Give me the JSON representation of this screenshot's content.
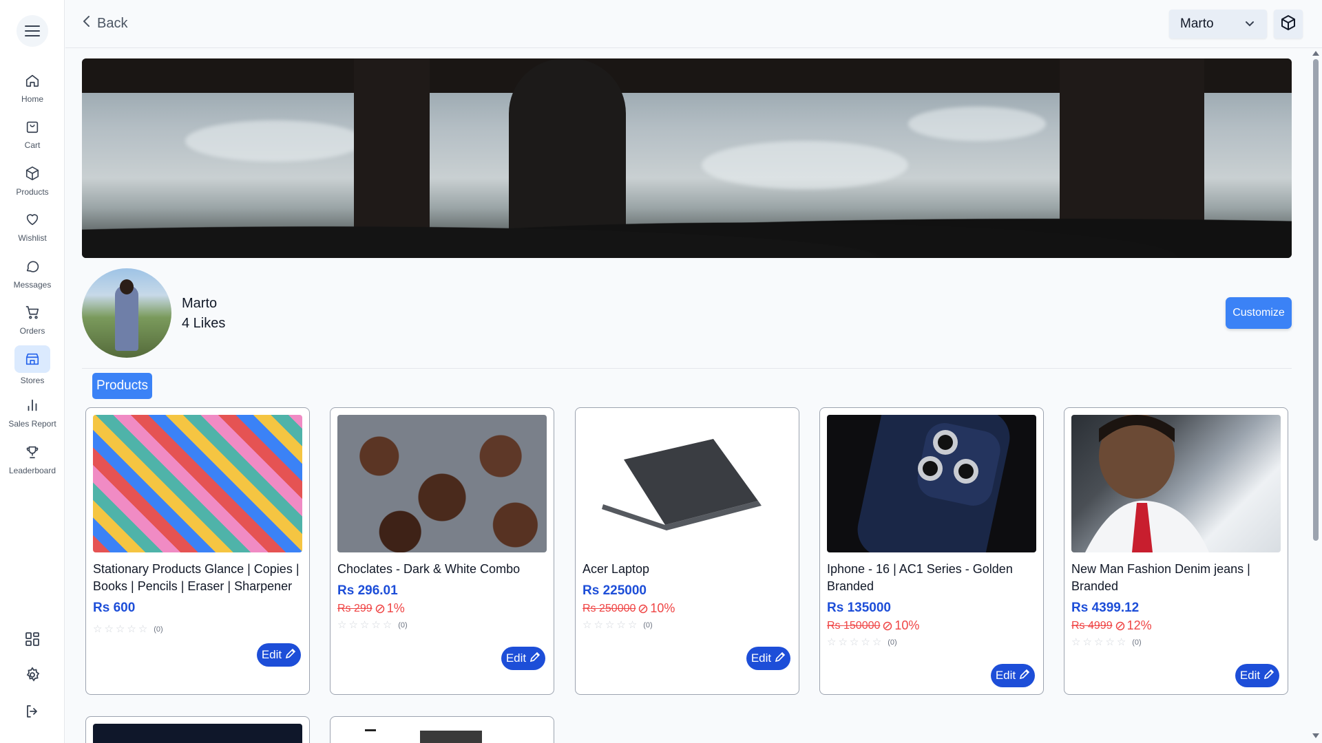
{
  "header": {
    "back_label": "Back",
    "user_select_value": "Marto"
  },
  "sidebar": {
    "items": [
      {
        "label": "Home",
        "icon": "home-icon"
      },
      {
        "label": "Cart",
        "icon": "bag-icon"
      },
      {
        "label": "Products",
        "icon": "box-icon"
      },
      {
        "label": "Wishlist",
        "icon": "heart-icon"
      },
      {
        "label": "Messages",
        "icon": "chat-icon"
      },
      {
        "label": "Orders",
        "icon": "cart-icon"
      },
      {
        "label": "Stores",
        "icon": "store-icon",
        "active": true
      },
      {
        "label": "Sales Report",
        "icon": "bar-chart-icon"
      },
      {
        "label": "Leaderboard",
        "icon": "trophy-icon"
      }
    ],
    "bottom_icons": [
      "dashboard-grid-icon",
      "settings-icon",
      "logout-icon"
    ]
  },
  "profile": {
    "name": "Marto",
    "likes": "4 Likes",
    "customize_label": "Customize"
  },
  "section": {
    "products_label": "Products"
  },
  "products": [
    {
      "title": "Stationary Products Glance | Copies | Books | Pencils | Eraser | Sharpener |...",
      "price": "Rs 600",
      "old_price": "",
      "discount": "",
      "rating_count": "(0)",
      "edit_label": "Edit"
    },
    {
      "title": "Choclates - Dark & White Combo",
      "price": "Rs 296.01",
      "old_price": "Rs 299",
      "discount": "1%",
      "rating_count": "(0)",
      "edit_label": "Edit"
    },
    {
      "title": "Acer Laptop",
      "price": "Rs 225000",
      "old_price": "Rs 250000",
      "discount": "10%",
      "rating_count": "(0)",
      "edit_label": "Edit"
    },
    {
      "title": "Iphone - 16 | AC1 Series - Golden Branded",
      "price": "Rs 135000",
      "old_price": "Rs 150000",
      "discount": "10%",
      "rating_count": "(0)",
      "edit_label": "Edit"
    },
    {
      "title": "New Man Fashion Denim jeans | Branded",
      "price": "Rs 4399.12",
      "old_price": "Rs 4999",
      "discount": "12%",
      "rating_count": "(0)",
      "edit_label": "Edit"
    }
  ],
  "colors": {
    "accent": "#3b82f6",
    "price": "#1d4ed8",
    "discount": "#ef4444"
  }
}
